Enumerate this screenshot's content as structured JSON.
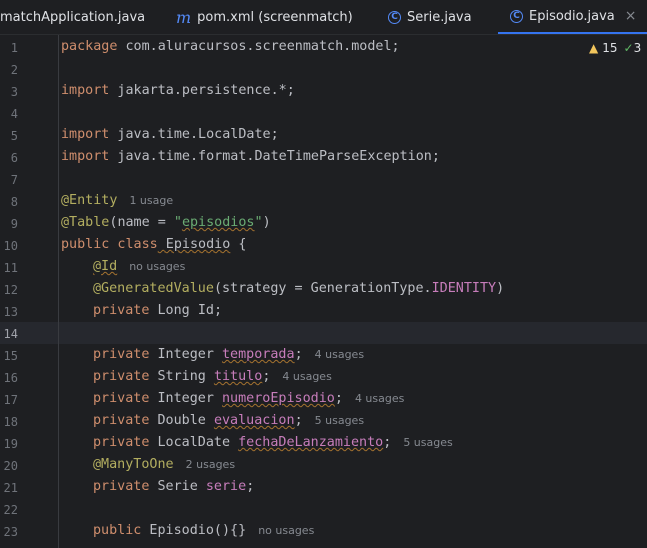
{
  "tabs": [
    {
      "label": "matchApplication.java",
      "icon": "class-icon"
    },
    {
      "label": "pom.xml (screenmatch)",
      "icon": "maven-icon"
    },
    {
      "label": "Serie.java",
      "icon": "class-icon"
    },
    {
      "label": "Episodio.java",
      "icon": "class-icon",
      "active": true,
      "close": "×"
    }
  ],
  "inspections": {
    "warnings": "15",
    "ok_partial": "3"
  },
  "line_numbers": [
    "1",
    "2",
    "3",
    "4",
    "5",
    "6",
    "7",
    "8",
    "9",
    "10",
    "11",
    "12",
    "13",
    "14",
    "15",
    "16",
    "17",
    "18",
    "19",
    "20",
    "21",
    "22",
    "23"
  ],
  "current_line": "14",
  "code": {
    "l1_kw": "package",
    "l1_rest": " com.aluracursos.screenmatch.model;",
    "l3_kw": "import",
    "l3_rest": " jakarta.persistence.*;",
    "l5_kw": "import",
    "l5_rest": " java.time.LocalDate;",
    "l6_kw": "import",
    "l6_rest": " java.time.format.DateTimeParseException;",
    "l8_ann": "@Entity",
    "l8_hint": "1 usage",
    "l9_ann": "@Table",
    "l9_open": "(",
    "l9_param": "name",
    "l9_eq": " = ",
    "l9_str_q1": "\"",
    "l9_str": "episodios",
    "l9_str_q2": "\"",
    "l9_close": ")",
    "l10_kw": "public class",
    "l10_name": " Episodio",
    "l10_brace": " {",
    "l11_ann": "@Id",
    "l11_hint": "no usages",
    "l12_ann": "@GeneratedValue",
    "l12_open": "(",
    "l12_param": "strategy",
    "l12_eq": " = GenerationType.",
    "l12_const": "IDENTITY",
    "l12_close": ")",
    "l13_kw": "private",
    "l13_type": " Long ",
    "l13_name": "Id",
    "l13_semi": ";",
    "l15_kw": "private",
    "l15_type": " Integer ",
    "l15_name": "temporada",
    "l15_semi": ";",
    "l15_hint": "4 usages",
    "l16_kw": "private",
    "l16_type": " String ",
    "l16_name": "titulo",
    "l16_semi": ";",
    "l16_hint": "4 usages",
    "l17_kw": "private",
    "l17_type": " Integer ",
    "l17_name": "numeroEpisodio",
    "l17_semi": ";",
    "l17_hint": "4 usages",
    "l18_kw": "private",
    "l18_type": " Double ",
    "l18_name": "evaluacion",
    "l18_semi": ";",
    "l18_hint": "5 usages",
    "l19_kw": "private",
    "l19_type": " LocalDate ",
    "l19_name": "fechaDeLanzamiento",
    "l19_semi": ";",
    "l19_hint": "5 usages",
    "l20_ann": "@ManyToOne",
    "l20_hint": "2 usages",
    "l21_kw": "private",
    "l21_type": " Serie ",
    "l21_name": "serie",
    "l21_semi": ";",
    "l23_kw": "public",
    "l23_name": " Episodio(){}",
    "l23_hint": "no usages"
  }
}
